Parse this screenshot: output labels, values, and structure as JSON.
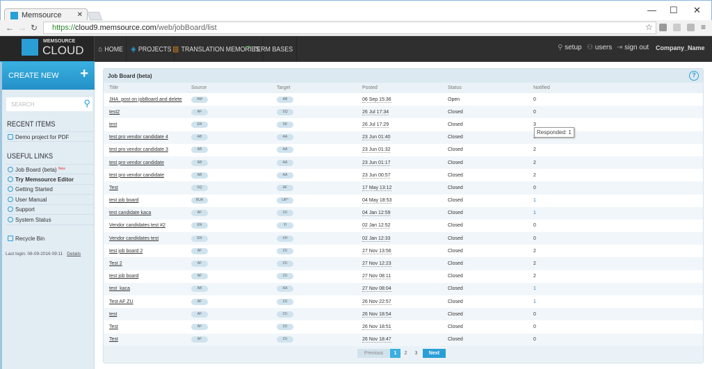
{
  "browser": {
    "tab_title": "Memsource",
    "url_scheme": "https://",
    "url_host": "cloud9.memsource.com",
    "url_path": "/web/jobBoard/list"
  },
  "header": {
    "logo_top": "MEMSOURCE",
    "logo_bottom": "CLOUD",
    "nav": [
      "HOME",
      "PROJECTS",
      "TRANSLATION MEMORIES",
      "TERM BASES"
    ],
    "setup": "setup",
    "users": "users",
    "sign_out": "sign out",
    "company": "Company_Name"
  },
  "sidebar": {
    "create_new": "CREATE NEW",
    "search_placeholder": "SEARCH",
    "recent_title": "RECENT ITEMS",
    "recent": [
      "Demo project for PDF"
    ],
    "useful_title": "USEFUL LINKS",
    "links": [
      "Job Board (beta)",
      "Try Memsource Editor",
      "Getting Started",
      "User Manual",
      "Support",
      "System Status"
    ],
    "new_badge": "New",
    "recycle": "Recycle Bin",
    "last_login": "Last login: 08-09-2016 09:11",
    "details": "Details"
  },
  "panel": {
    "title": "Job Board (beta)",
    "help": "?",
    "columns": [
      "Title",
      "Source",
      "Target",
      "Posted",
      "Status",
      "Notified"
    ],
    "rows": [
      [
        "JHA_post on jobBoard and delete",
        "AM",
        "AB",
        "06 Sep 15:36",
        "Open",
        "0"
      ],
      [
        "test2",
        "AF",
        "SQ",
        "26 Jul 17:34",
        "Closed",
        "0"
      ],
      [
        "test",
        "EN",
        "SK",
        "26 Jul 17:29",
        "Closed",
        "3"
      ],
      [
        "test pro vendor candidate 4",
        "AB",
        "AA",
        "23 Jun 01:40",
        "Closed",
        "3"
      ],
      [
        "test pro vendor candidate 3",
        "AB",
        "AA",
        "23 Jun 01:32",
        "Closed",
        "2"
      ],
      [
        "test pro vendor candidate",
        "AB",
        "AA",
        "23 Jun 01:17",
        "Closed",
        "2"
      ],
      [
        "test pro vendor candidate",
        "AB",
        "AA",
        "23 Jun 00:57",
        "Closed",
        "2"
      ],
      [
        "Test",
        "SQ",
        "AF",
        "17 May 13:12",
        "Closed",
        "0"
      ],
      [
        "test job board",
        "BUA",
        "UR^",
        "04 May 18:53",
        "Closed",
        "1"
      ],
      [
        "test candidate kaca",
        "AF",
        "ZU",
        "04 Jan 12:59",
        "Closed",
        "1"
      ],
      [
        "Vendor candidates test #2",
        "EN",
        "YI",
        "02 Jan 12:52",
        "Closed",
        "0"
      ],
      [
        "Vendor candidates test",
        "EN",
        "XH",
        "02 Jan 12:33",
        "Closed",
        "0"
      ],
      [
        "test job board 2",
        "AF",
        "ZU",
        "27 Nov 13:56",
        "Closed",
        "2"
      ],
      [
        "Test 2",
        "AF",
        "ZU",
        "27 Nov 12:23",
        "Closed",
        "2"
      ],
      [
        "test job board",
        "AF",
        "ZU",
        "27 Nov 08:11",
        "Closed",
        "2"
      ],
      [
        "test_kaca",
        "AB",
        "AA",
        "27 Nov 08:04",
        "Closed",
        "1"
      ],
      [
        "Test AF ZU",
        "AF",
        "ZU",
        "26 Nov 22:57",
        "Closed",
        "1"
      ],
      [
        "test",
        "AF",
        "ZU",
        "26 Nov 18:54",
        "Closed",
        "0"
      ],
      [
        "Test",
        "AF",
        "ZU",
        "26 Nov 18:51",
        "Closed",
        "0"
      ],
      [
        "Test",
        "AF",
        "ZU",
        "26 Nov 18:47",
        "Closed",
        "0"
      ]
    ],
    "tooltip": "Responded: 1"
  },
  "pager": {
    "previous": "Previous",
    "pages": [
      "1",
      "2",
      "3"
    ],
    "next": "Next"
  }
}
